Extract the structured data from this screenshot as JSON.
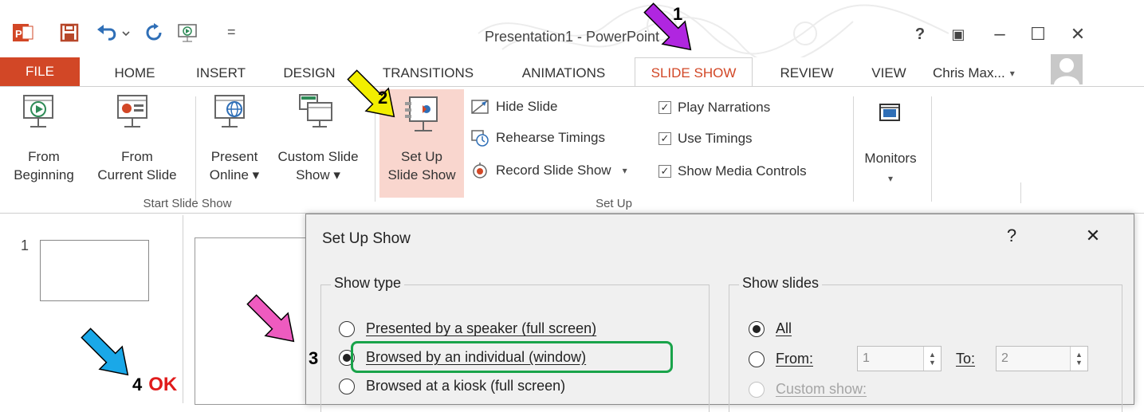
{
  "window": {
    "title": "Presentation1 - PowerPoint",
    "help_glyph": "?",
    "minimize_glyph": "–",
    "maximize_glyph": "☐",
    "close_glyph": "✕",
    "restore_ribbon_glyph": "▣",
    "qat_more_glyph": "="
  },
  "tabs": [
    "FILE",
    "HOME",
    "INSERT",
    "DESIGN",
    "TRANSITIONS",
    "ANIMATIONS",
    "SLIDE SHOW",
    "REVIEW",
    "VIEW"
  ],
  "active_tab": "SLIDE SHOW",
  "account": {
    "name": "Chris Max...",
    "caret": "▾"
  },
  "ribbon": {
    "start_group": {
      "label": "Start Slide Show",
      "from_beginning": [
        "From",
        "Beginning"
      ],
      "from_current": [
        "From",
        "Current Slide"
      ],
      "present_online": [
        "Present",
        "Online ▾"
      ],
      "custom_show": [
        "Custom Slide",
        "Show ▾"
      ]
    },
    "setup_group": {
      "label": "Set Up",
      "setup_show": [
        "Set Up",
        "Slide Show"
      ],
      "hide_slide": "Hide Slide",
      "rehearse": "Rehearse Timings",
      "record": "Record Slide Show",
      "record_caret": "▾",
      "play_narrations": "Play Narrations",
      "use_timings": "Use Timings",
      "show_media": "Show Media Controls",
      "check": "✓"
    },
    "monitors_group": {
      "label": "Monitors",
      "caret": "▾"
    }
  },
  "slide_pane": {
    "slide_number": "1"
  },
  "dialog": {
    "title": "Set Up Show",
    "help": "?",
    "close": "✕",
    "show_type": {
      "legend": "Show type",
      "options": [
        {
          "label": "Presented by a speaker (full screen)",
          "selected": false
        },
        {
          "label": "Browsed by an individual (window)",
          "selected": true
        },
        {
          "label": "Browsed at a kiosk (full screen)",
          "selected": false
        }
      ]
    },
    "show_slides": {
      "legend": "Show slides",
      "all": "All",
      "from": "From:",
      "from_value": "1",
      "to": "To:",
      "to_value": "2",
      "custom": "Custom show:",
      "spin_up": "▲",
      "spin_down": "▼"
    }
  },
  "annotations": {
    "step1": "1",
    "step2": "2",
    "step3": "3",
    "step4": "4",
    "ok": "OK",
    "colors": {
      "purple": "#b026e0",
      "yellow": "#f2ee00",
      "pink": "#ee5bbf",
      "blue": "#1aa8e8",
      "green_box": "#19a34a",
      "ok_red": "#e01b1b"
    }
  },
  "colors": {
    "accent": "#d24726"
  }
}
